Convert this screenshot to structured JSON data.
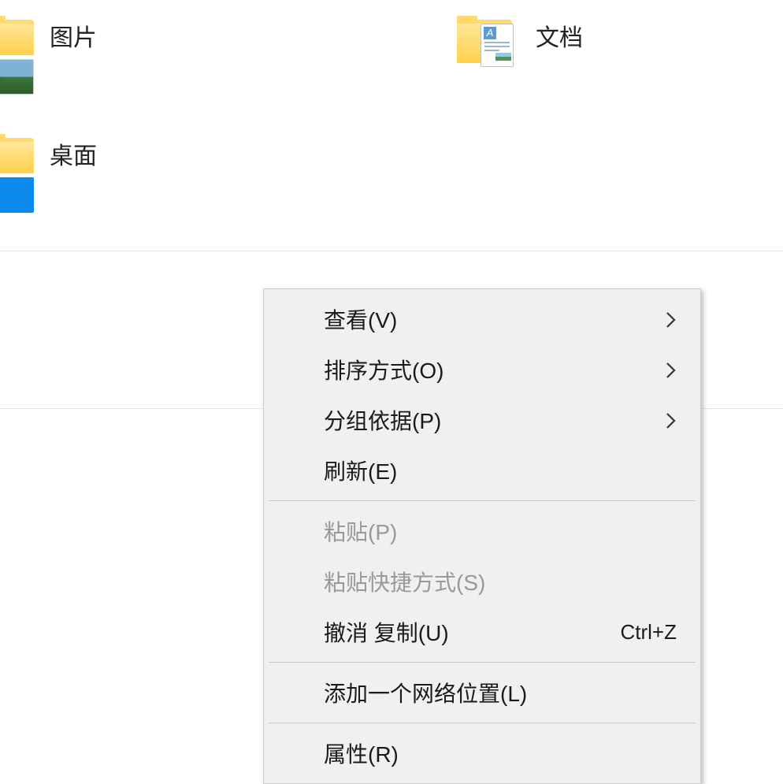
{
  "folders": {
    "pictures": {
      "label": "图片"
    },
    "desktop": {
      "label": "桌面"
    },
    "documents": {
      "label": "文档"
    }
  },
  "contextMenu": {
    "items": [
      {
        "label": "查看(V)",
        "hasSubmenu": true
      },
      {
        "label": "排序方式(O)",
        "hasSubmenu": true
      },
      {
        "label": "分组依据(P)",
        "hasSubmenu": true
      },
      {
        "label": "刷新(E)"
      },
      {
        "separator": true
      },
      {
        "label": "粘贴(P)",
        "disabled": true
      },
      {
        "label": "粘贴快捷方式(S)",
        "disabled": true
      },
      {
        "label": "撤消 复制(U)",
        "shortcut": "Ctrl+Z"
      },
      {
        "separator": true
      },
      {
        "label": "添加一个网络位置(L)"
      },
      {
        "separator": true
      },
      {
        "label": "属性(R)"
      }
    ]
  }
}
